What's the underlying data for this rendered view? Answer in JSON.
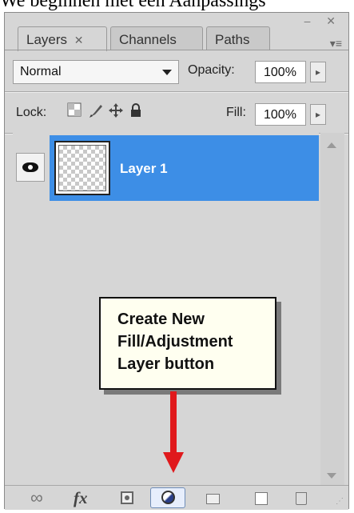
{
  "caption": "We beginnen met een Aanpassings",
  "panel": {
    "window_buttons": "– ✕",
    "tabs": [
      {
        "label": "Layers",
        "close": "✕"
      },
      {
        "label": "Channels"
      },
      {
        "label": "Paths"
      }
    ],
    "menu_icon": "▾≡",
    "blend_mode": "Normal",
    "opacity_label": "Opacity:",
    "opacity_value": "100%",
    "lock_label": "Lock:",
    "fill_label": "Fill:",
    "fill_value": "100%",
    "stepper_glyph": "▸",
    "layers": [
      {
        "name": "Layer 1",
        "visible": true,
        "selected": true
      }
    ],
    "selection_color": "#3d8ee6",
    "bottom_icons": [
      "link-icon",
      "fx-icon",
      "add-mask-icon",
      "new-fill-adjustment-layer-icon",
      "group-folder-icon",
      "new-layer-icon",
      "trash-icon"
    ],
    "fx_text": "fx",
    "link_glyph": "∞"
  },
  "callout": {
    "lines": [
      "Create New",
      "Fill/Adjustment",
      "Layer button"
    ],
    "arrow_color": "#e0191c"
  }
}
